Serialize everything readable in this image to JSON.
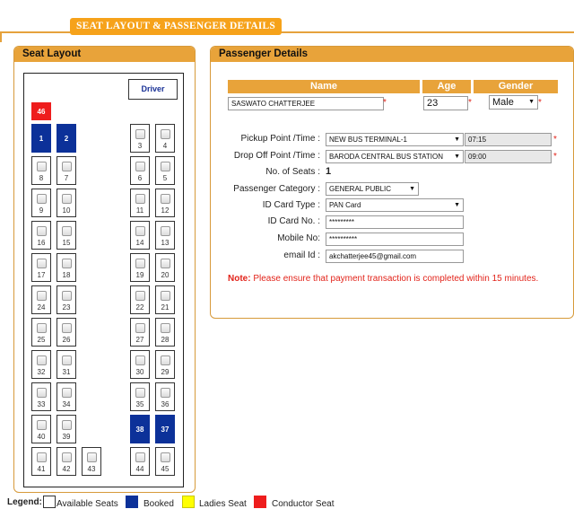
{
  "header": {
    "title": "SEAT LAYOUT & PASSENGER DETAILS"
  },
  "seat_panel": {
    "title": "Seat Layout",
    "driver_label": "Driver"
  },
  "passenger_panel": {
    "title": "Passenger Details",
    "columns": {
      "name": "Name",
      "age": "Age",
      "gender": "Gender"
    },
    "name_value": "SASWATO CHATTERJEE",
    "age_value": "23",
    "gender_value": "Male",
    "pickup_label": "Pickup Point /Time :",
    "pickup_point": "NEW BUS TERMINAL-1",
    "pickup_time": "07:15",
    "dropoff_label": "Drop Off Point /Time :",
    "dropoff_point": "BARODA CENTRAL BUS STATION",
    "dropoff_time": "09:00",
    "seats_label": "No. of Seats :",
    "seats_value": "1",
    "category_label": "Passenger Category :",
    "category_value": "GENERAL PUBLIC",
    "idtype_label": "ID Card Type :",
    "idtype_value": "PAN Card",
    "idno_label": "ID Card No. :",
    "idno_value": "*********",
    "mobile_label": "Mobile No:",
    "mobile_value": "**********",
    "email_label": "email Id :",
    "email_value": "akchatterjee45@gmail.com",
    "note_prefix": "Note:",
    "note_text": " Please ensure that payment transaction is completed within 15 minutes.",
    "required_mark": "*"
  },
  "seats": {
    "s46": "46",
    "s1": "1",
    "s2": "2",
    "s3": "3",
    "s4": "4",
    "s8": "8",
    "s7": "7",
    "s6": "6",
    "s5": "5",
    "s9": "9",
    "s10": "10",
    "s11": "11",
    "s12": "12",
    "s16": "16",
    "s15": "15",
    "s14": "14",
    "s13": "13",
    "s17": "17",
    "s18": "18",
    "s19": "19",
    "s20": "20",
    "s24": "24",
    "s23": "23",
    "s22": "22",
    "s21": "21",
    "s25": "25",
    "s26": "26",
    "s27": "27",
    "s28": "28",
    "s32": "32",
    "s31": "31",
    "s30": "30",
    "s29": "29",
    "s33": "33",
    "s34": "34",
    "s35": "35",
    "s36": "36",
    "s40": "40",
    "s39": "39",
    "s38": "38",
    "s37": "37",
    "s41": "41",
    "s42": "42",
    "s43": "43",
    "s44": "44",
    "s45": "45"
  },
  "legend": {
    "title": "Legend:",
    "available": "Available Seats",
    "booked": "Booked",
    "ladies": "Ladies Seat",
    "conductor": "Conductor Seat"
  },
  "colors": {
    "header_orange": "#f6a21a",
    "panel_orange": "#e8a33a",
    "booked_blue": "#0c3199",
    "conductor_red": "#ee1d1d",
    "ladies_yellow": "#ffff00",
    "required_red": "#e2231a"
  }
}
